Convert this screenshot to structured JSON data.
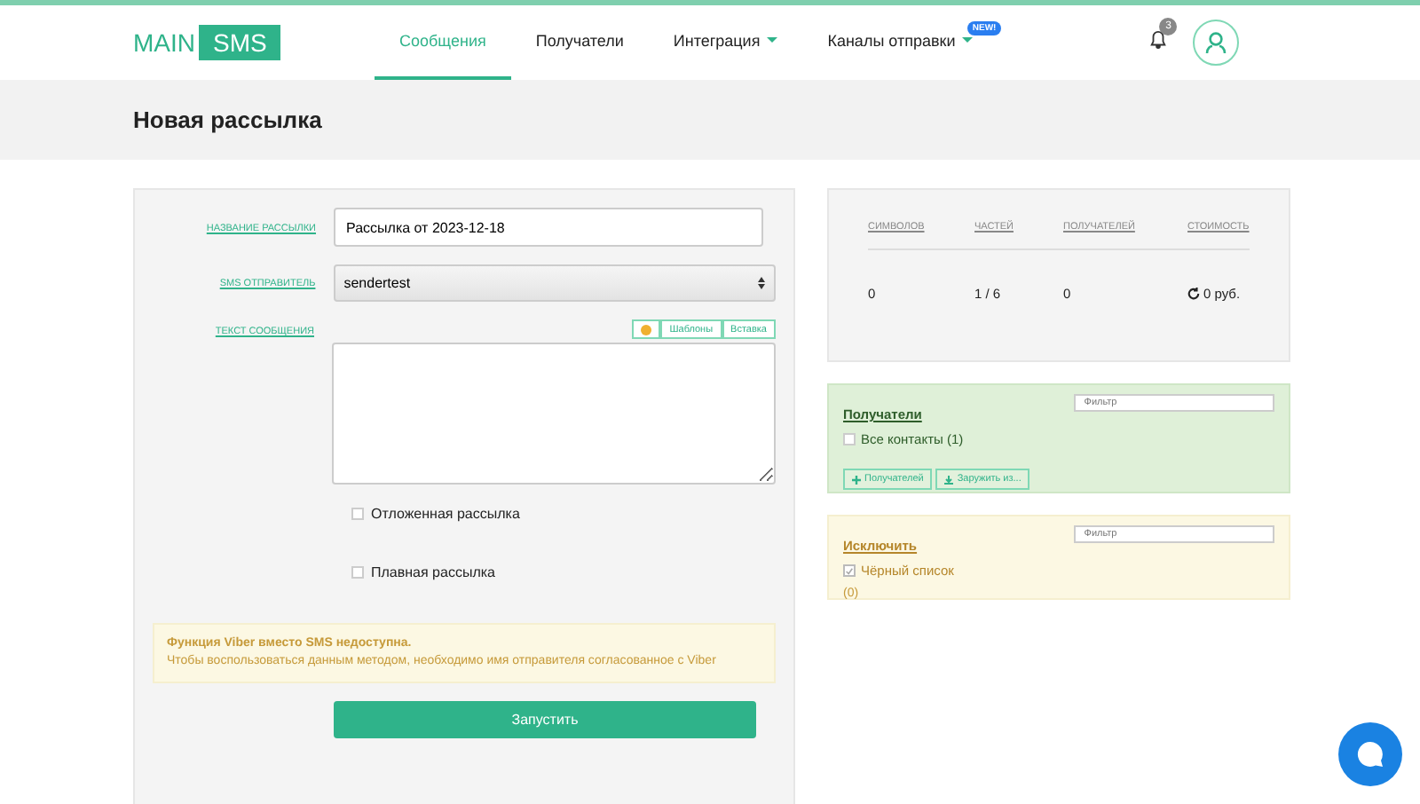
{
  "header": {
    "logo": {
      "left": "MAIN",
      "right": "SMS"
    },
    "nav": [
      {
        "label": "Сообщения",
        "selected": true,
        "caret": false
      },
      {
        "label": "Получатели",
        "selected": false,
        "caret": false
      },
      {
        "label": "Интеграция",
        "selected": false,
        "caret": true
      },
      {
        "label": "Каналы отправки",
        "selected": false,
        "caret": true,
        "badge": "NEW!"
      }
    ],
    "notifications": "3"
  },
  "page_title": "Новая рассылка",
  "form": {
    "name": {
      "label": "НАЗВАНИЕ РАССЫЛКИ",
      "value": "Рассылка от 2023-12-18"
    },
    "sender": {
      "label": "SMS ОТПРАВИТЕЛЬ",
      "value": "sendertest"
    },
    "message": {
      "label": "ТЕКСТ СООБЩЕНИЯ",
      "tools": [
        "Шаблоны",
        "Вставка"
      ]
    },
    "options": [
      {
        "label": "Отложенная рассылка",
        "checked": false
      },
      {
        "label": "Плавная рассылка",
        "checked": false
      }
    ],
    "alert": {
      "title": "Функция Viber вместо SMS недоступна.",
      "text": "Чтобы воспользоваться данным методом, необходимо имя отправителя согласованное с Viber"
    },
    "submit": "Запустить"
  },
  "stats": {
    "columns": [
      "СИМВОЛОВ",
      "ЧАСТЕЙ",
      "ПОЛУЧАТЕЛЕЙ",
      "СТОИМОСТЬ"
    ],
    "values": [
      "0",
      "1 / 6",
      "0",
      "0 руб."
    ]
  },
  "recipients": {
    "title": "Получатели",
    "filter_placeholder": "Фильтр",
    "items": [
      {
        "label": "Все контакты (1)",
        "checked": false
      }
    ],
    "buttons": [
      "Получателей",
      "Заружить из..."
    ]
  },
  "exclude": {
    "title": "Исключить",
    "filter_placeholder": "Фильтр",
    "items": [
      {
        "label": "Чёрный список",
        "checked": true
      }
    ],
    "count": "(0)"
  }
}
